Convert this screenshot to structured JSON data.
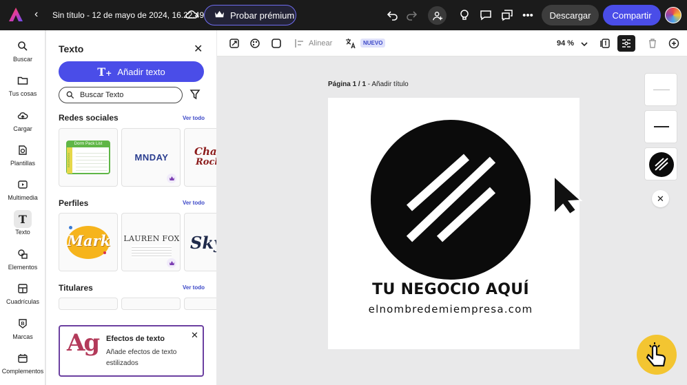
{
  "topbar": {
    "doc_title": "Sin título - 12 de mayo de 2024, 16.22.49",
    "premium_label": "Probar prémium",
    "download_label": "Descargar",
    "share_label": "Compartir"
  },
  "rail": [
    {
      "label": "Buscar",
      "icon": "search-icon"
    },
    {
      "label": "Tus cosas",
      "icon": "folder-icon"
    },
    {
      "label": "Cargar",
      "icon": "upload-icon"
    },
    {
      "label": "Plantillas",
      "icon": "templates-icon"
    },
    {
      "label": "Multimedia",
      "icon": "media-icon"
    },
    {
      "label": "Texto",
      "icon": "text-icon",
      "active": true
    },
    {
      "label": "Elementos",
      "icon": "elements-icon"
    },
    {
      "label": "Cuadrículas",
      "icon": "grids-icon"
    },
    {
      "label": "Marcas",
      "icon": "brands-icon"
    },
    {
      "label": "Complementos",
      "icon": "addons-icon"
    }
  ],
  "panel": {
    "title": "Texto",
    "add_text_label": "Añadir texto",
    "search_placeholder": "Buscar Texto",
    "sections": [
      {
        "title": "Redes sociales",
        "link": "Ver todo"
      },
      {
        "title": "Perfiles",
        "link": "Ver todo"
      },
      {
        "title": "Titulares",
        "link": "Ver todo"
      }
    ],
    "thumbs": {
      "dorm_title": "Dorm Pack List",
      "dorm_side": "BEDROOM",
      "monday": "MNDAY",
      "chalk": "Cha",
      "chalk2": "Rock",
      "mark": "Mark",
      "lauren": "LAUREN FOX",
      "sky": "Sky"
    },
    "effects": {
      "glyph": "Ag",
      "title": "Efectos de texto",
      "desc": "Añade efectos de texto estilizados"
    }
  },
  "canvas_toolbar": {
    "align_label": "Alinear",
    "new_badge": "NUEVO",
    "zoom": "94 %"
  },
  "canvas": {
    "page_label_bold": "Página 1 / 1",
    "page_label_rest": " - Añadir título",
    "headline": "TU NEGOCIO AQUÍ",
    "website": "elnombredemiempresa.com"
  }
}
